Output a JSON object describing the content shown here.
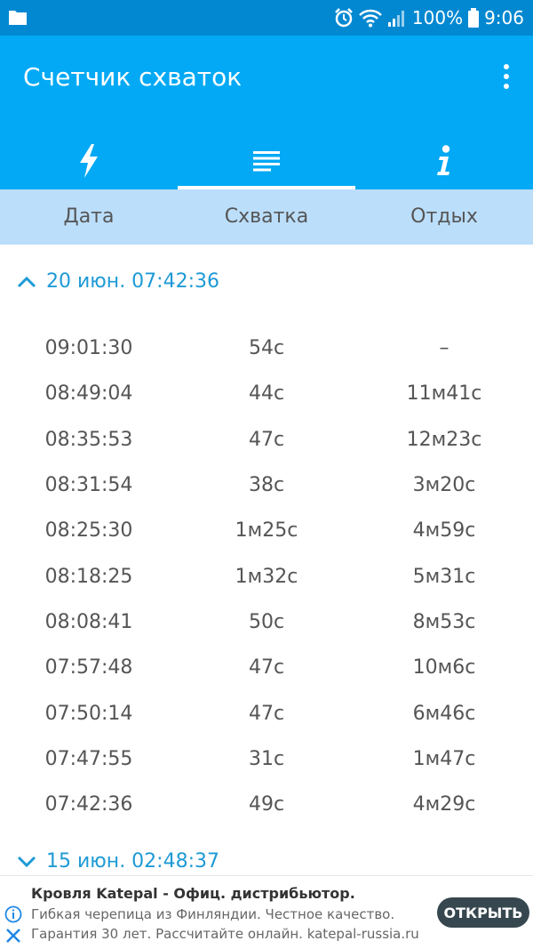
{
  "status_bar": {
    "battery": "100%",
    "time": "9:06",
    "icons": [
      "folder-icon",
      "alarm-icon",
      "wifi-icon",
      "signal-icon",
      "battery-icon"
    ]
  },
  "app_bar": {
    "title": "Счетчик схваток",
    "menu_icon": "more-vert-icon",
    "tabs": [
      {
        "icon": "lightning-icon",
        "active": false
      },
      {
        "icon": "list-icon",
        "active": true
      },
      {
        "icon": "info-icon",
        "active": false
      }
    ]
  },
  "table": {
    "columns": [
      "Дата",
      "Схватка",
      "Отдых"
    ],
    "groups": [
      {
        "label": "20 июн. 07:42:36",
        "expanded": true,
        "rows": [
          [
            "09:01:30",
            "54с",
            "–"
          ],
          [
            "08:49:04",
            "44с",
            "11м41с"
          ],
          [
            "08:35:53",
            "47с",
            "12м23с"
          ],
          [
            "08:31:54",
            "38с",
            "3м20с"
          ],
          [
            "08:25:30",
            "1м25с",
            "4м59с"
          ],
          [
            "08:18:25",
            "1м32с",
            "5м31с"
          ],
          [
            "08:08:41",
            "50с",
            "8м53с"
          ],
          [
            "07:57:48",
            "47с",
            "10м6с"
          ],
          [
            "07:50:14",
            "47с",
            "6м46с"
          ],
          [
            "07:47:55",
            "31с",
            "1м47с"
          ],
          [
            "07:42:36",
            "49с",
            "4м29с"
          ]
        ]
      },
      {
        "label": "15 июн. 02:48:37",
        "expanded": false,
        "rows": []
      }
    ]
  },
  "ad": {
    "title": "Кровля Katepal - Офиц. дистрибьютор.",
    "line1": "Гибкая черепица из Финляндии. Честное качество.",
    "line2": "Гарантия 30 лет. Рассчитайте онлайн. katepal-russia.ru",
    "button": "ОТКРЫТЬ"
  },
  "colors": {
    "status_bar": "#0288d1",
    "app_bar": "#03a9f4",
    "column_header": "#bbdefb",
    "group_label": "#1e9ad6"
  }
}
